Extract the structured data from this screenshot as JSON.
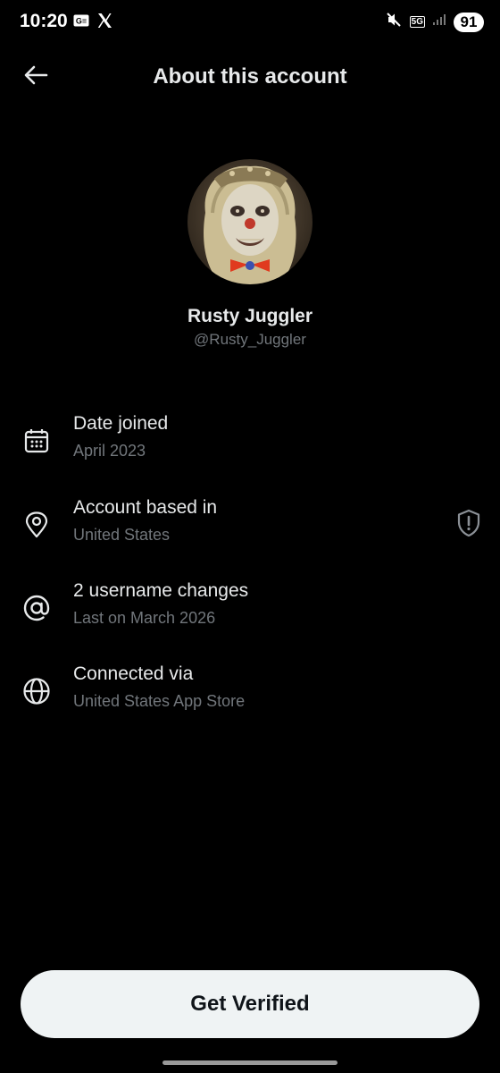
{
  "status_bar": {
    "time": "10:20",
    "network": "5G",
    "battery": "91"
  },
  "header": {
    "title": "About this account"
  },
  "profile": {
    "display_name": "Rusty Juggler",
    "handle": "@Rusty_Juggler"
  },
  "info": [
    {
      "icon": "calendar-icon",
      "title": "Date joined",
      "value": "April 2023"
    },
    {
      "icon": "location-pin-icon",
      "title": "Account based in",
      "value": "United States"
    },
    {
      "icon": "at-sign-icon",
      "title": "2 username changes",
      "value": "Last on March 2026"
    },
    {
      "icon": "globe-icon",
      "title": "Connected via",
      "value": "United States App Store"
    }
  ],
  "verify_button": {
    "label": "Get Verified"
  },
  "colors": {
    "background": "#000000",
    "primary_text": "#e7e9ea",
    "secondary_text": "#71767b",
    "button_bg": "#eff3f4",
    "button_text": "#0f1419"
  }
}
